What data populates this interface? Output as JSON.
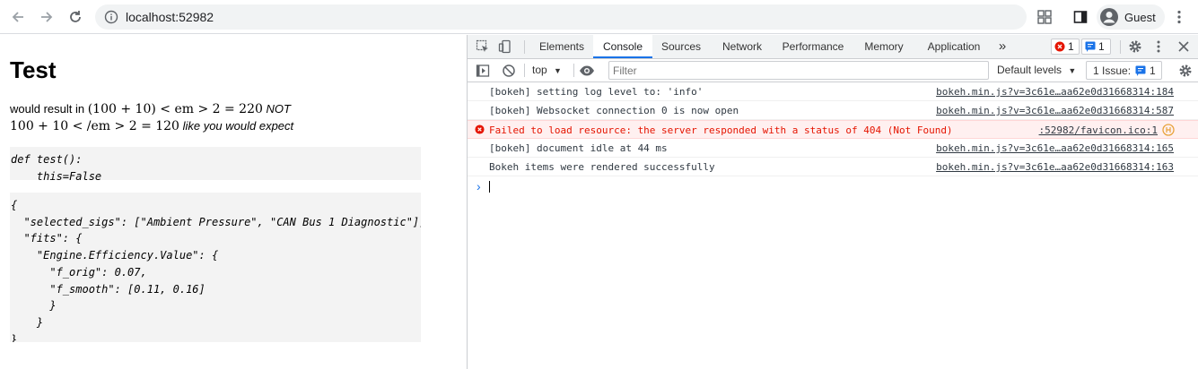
{
  "browser": {
    "url": "localhost:52982",
    "profile_name": "Guest"
  },
  "page": {
    "title": "Test",
    "line1_prefix": "would result in ",
    "line1_math": "(100 + 10) < em > 2 = 220",
    "line1_suffix": " NOT",
    "line2_math": "100 + 10 < /em > 2 = 120",
    "line2_suffix": " like you would expect",
    "code1": "def test():\n    this=False",
    "code2": "{\n  \"selected_sigs\": [\"Ambient Pressure\", \"CAN Bus 1 Diagnostic\"],\n  \"fits\": {\n    \"Engine.Efficiency.Value\": {\n      \"f_orig\": 0.07,\n      \"f_smooth\": [0.11, 0.16]\n      }\n    }\n}"
  },
  "devtools": {
    "tabs": [
      "Elements",
      "Console",
      "Sources",
      "Network",
      "Performance",
      "Memory",
      "Application"
    ],
    "more": "»",
    "error_count": "1",
    "message_count": "1",
    "context": "top",
    "filter_placeholder": "Filter",
    "levels": "Default levels",
    "issues_label": "1 Issue:",
    "issues_count": "1",
    "messages": [
      {
        "text": "[bokeh] setting log level to: 'info'",
        "source": "bokeh.min.js?v=3c61e…aa62e0d31668314:184"
      },
      {
        "text": "[bokeh] Websocket connection 0 is now open",
        "source": "bokeh.min.js?v=3c61e…aa62e0d31668314:587"
      },
      {
        "text": "Failed to load resource: the server responded with a status of 404 (Not Found)",
        "source": ":52982/favicon.ico:1"
      },
      {
        "text": "[bokeh] document idle at 44 ms",
        "source": "bokeh.min.js?v=3c61e…aa62e0d31668314:165"
      },
      {
        "text": "Bokeh items were rendered successfully",
        "source": "bokeh.min.js?v=3c61e…aa62e0d31668314:163"
      }
    ],
    "prompt": "›"
  },
  "colors": {
    "accent": "#1a73e8",
    "error": "#e51400",
    "error_bg": "#fff0f0"
  }
}
